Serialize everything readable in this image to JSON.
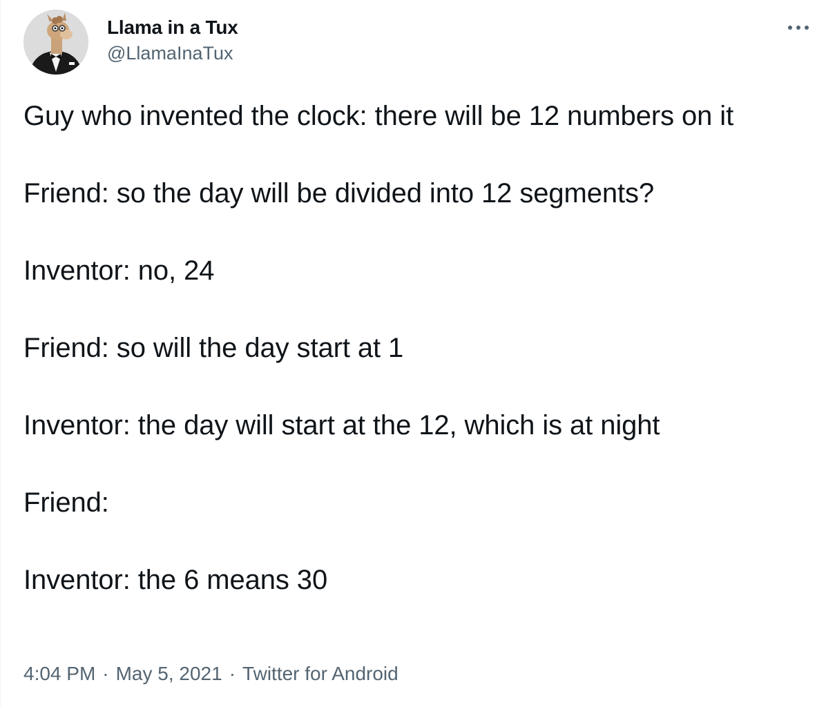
{
  "author": {
    "display_name": "Llama in a Tux",
    "handle": "@LlamaInaTux",
    "avatar_icon": "llama-in-tuxedo-avatar"
  },
  "actions": {
    "more_icon": "more-horizontal-icon"
  },
  "tweet": {
    "paragraphs": [
      "Guy who invented the clock: there will be 12 numbers on it",
      "Friend: so the day will be divided into 12 segments?",
      "Inventor: no, 24",
      "Friend: so will the day start at 1",
      "Inventor: the day will start at the 12, which is at night",
      "Friend:",
      "Inventor: the 6 means 30"
    ]
  },
  "meta": {
    "time": "4:04 PM",
    "separator": "·",
    "date": "May 5, 2021",
    "source": "Twitter for Android"
  },
  "colors": {
    "text_primary": "#0f1419",
    "text_secondary": "#536471",
    "background": "#ffffff"
  }
}
